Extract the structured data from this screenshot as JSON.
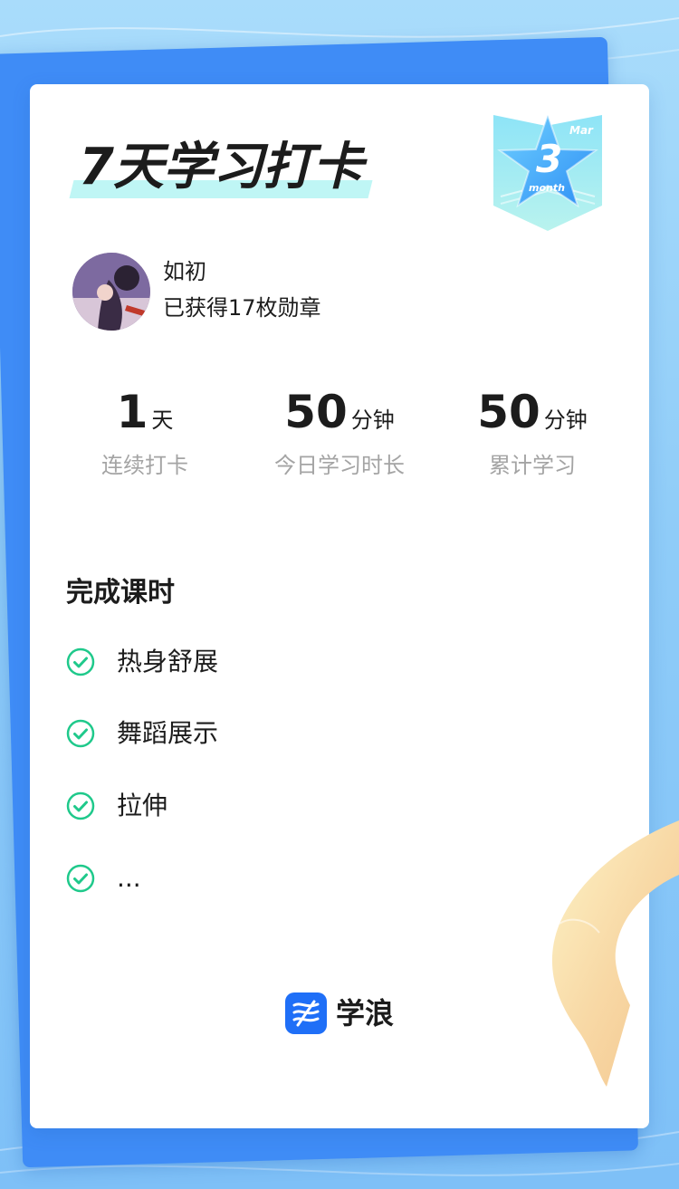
{
  "header": {
    "title": "7天学习打卡",
    "badge": {
      "month_abbr": "Mar",
      "number": "3",
      "unit": "month"
    }
  },
  "user": {
    "name": "如初",
    "medals_text": "已获得17枚勋章"
  },
  "stats": [
    {
      "value": "1",
      "unit": "天",
      "label": "连续打卡"
    },
    {
      "value": "50",
      "unit": "分钟",
      "label": "今日学习时长"
    },
    {
      "value": "50",
      "unit": "分钟",
      "label": "累计学习"
    }
  ],
  "lessons": {
    "title": "完成课时",
    "items": [
      {
        "label": "热身舒展",
        "status": "completed"
      },
      {
        "label": "舞蹈展示",
        "status": "completed"
      },
      {
        "label": "拉伸",
        "status": "completed"
      },
      {
        "label": "...",
        "status": "completed"
      }
    ]
  },
  "brand": {
    "name": "学浪",
    "logo_icon": "xuelang-logo-icon"
  },
  "colors": {
    "background": "#a9dcfb",
    "back_card": "#3f8cf6",
    "check_green": "#1fc98b",
    "brand_blue": "#1f6ff7",
    "label_gray": "#a4a4a4",
    "title_highlight": "#bff6f5"
  }
}
